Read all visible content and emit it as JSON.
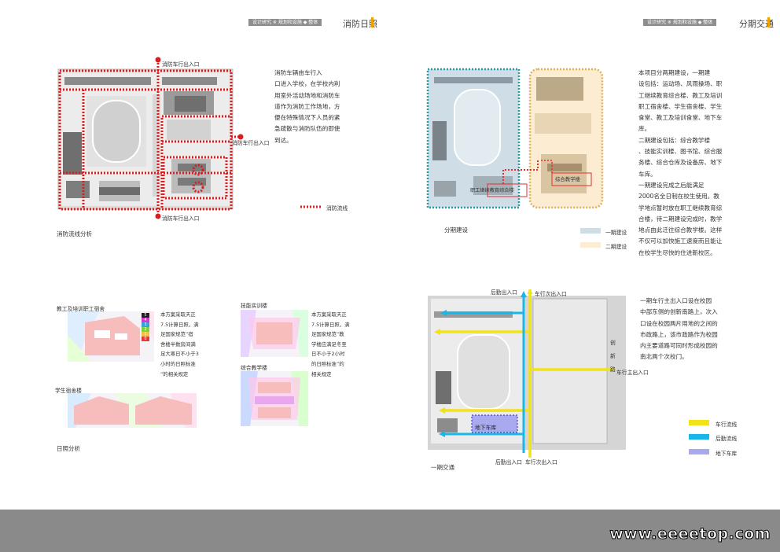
{
  "left_page": {
    "header": {
      "tag": "设计研究 ※ 规划和设施 ◆ 整体",
      "title": "消防日照"
    },
    "fire": {
      "entrance_top": "消防车行出入口",
      "entrance_right": "消防车行出入口",
      "entrance_bottom": "消防车行出入口",
      "legend": "消防流线",
      "caption": "消防流线分析",
      "text": "消防车辆由车行入\n口进入学校，在学校内利\n用室外活动场地和消防车\n道作为消防工作场地，方\n便在特殊情况下人员的紧\n急疏散与消防队伍的即使\n到达。"
    },
    "sun": {
      "label_dorm_staff": "教工及培训职工宿舍",
      "label_dorm_student": "学生宿舍楼",
      "label_training": "技能实训楼",
      "label_teaching": "综合教学楼",
      "text1": "本方案采取天正\n7.5计算日照，满\n足国家规范“宿\n舍楼半数房间满\n足大寒日不小于3\n小时的日照标准\n”的相关规定",
      "text2": "本方案采取天正\n7.5计算日照，满\n足国家规范“教\n学楼应满足冬至\n日不小于2小时\n的日照标准”的\n相关规定",
      "caption": "日照分析",
      "scale": [
        "5",
        "4",
        "3",
        "2",
        "1",
        "0"
      ]
    }
  },
  "right_page": {
    "header": {
      "tag": "设计研究 ※ 规划和设施 ◆ 整体",
      "title": "分期交通"
    },
    "phase": {
      "text": "本项目分两期建设，一期建\n设包括：运动场、风雨操场、职\n工继续教育综合楼、教工及培训\n职工宿舍楼、学生宿舍楼、学生\n食堂、教工及培训食堂、地下车\n库。\n二期建设包括：综合教学楼\n、技能实训楼、图书馆、综合服\n务楼、综合仓库及设备房、地下\n车库。\n一期建设完成之后能满足\n2000名全日制在校生使用。教\n学地点暂时放在职工继续教育综\n合楼，待二期建设完成时，教学\n地点由此迁往综合教学楼。这样\n不仅可以加快施工速度而且能让\n在校学生尽快的住进新校区。",
      "label_a": "职工继续教育综合楼",
      "label_b": "综合教学楼",
      "caption": "分期建设",
      "legend": [
        "一期建设",
        "二期建设"
      ],
      "colors": {
        "phase1": "#cfdde6",
        "phase2": "#fbecd2"
      }
    },
    "traffic": {
      "label_top_service": "后勤出入口",
      "label_top_car": "车行次出入口",
      "label_right_main": "车行主出入口",
      "road": "创\n新\n路",
      "label_bottom_service": "后勤出入口",
      "label_bottom_car": "车行次出入口",
      "garage": "地下车库",
      "caption": "一期交通",
      "text": "一期车行主出入口设在校园\n中部东侧的创新南路上，次入\n口设在校园两片用地的之间的\n市政路上，该市政路作为校园\n内主要道路可同时形成校园的\n南北两个次校门。",
      "legend": [
        "车行流线",
        "后勤流线",
        "地下车库"
      ],
      "colors": {
        "car": "#f2e21a",
        "service": "#19b6e8",
        "garage": "#a9a9f0"
      }
    }
  },
  "watermark": "www.eeeetop.com"
}
